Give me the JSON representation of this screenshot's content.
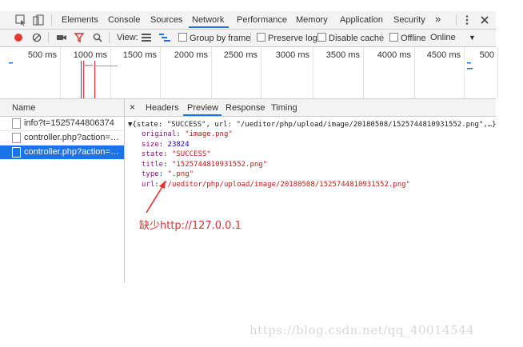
{
  "tabs": [
    "Elements",
    "Console",
    "Sources",
    "Network",
    "Performance",
    "Memory",
    "Application",
    "Security"
  ],
  "active_tab": "Network",
  "more_tabs": "»",
  "toolbar": {
    "view_label": "View:",
    "group_by_frame": "Group by frame",
    "preserve_log": "Preserve log",
    "disable_cache": "Disable cache",
    "offline": "Offline",
    "throttle": "Online"
  },
  "timeline": {
    "ticks": [
      "500 ms",
      "1000 ms",
      "1500 ms",
      "2000 ms",
      "2500 ms",
      "3000 ms",
      "3500 ms",
      "4000 ms",
      "4500 ms",
      "500"
    ]
  },
  "requests": {
    "header": "Name",
    "items": [
      {
        "name": "info?t=1525744806374"
      },
      {
        "name": "controller.php?action=upl..."
      },
      {
        "name": "controller.php?action=upl..."
      }
    ],
    "selected_index": 2
  },
  "detail_tabs": {
    "close": "×",
    "items": [
      "Headers",
      "Preview",
      "Response",
      "Timing"
    ],
    "active": "Preview"
  },
  "preview": {
    "summary": "{state: \"SUCCESS\", url: \"/ueditor/php/upload/image/20180508/1525744810931552.png\",…}",
    "fields": [
      {
        "key": "original",
        "value": "\"image.png\"",
        "type": "string"
      },
      {
        "key": "size",
        "value": "23824",
        "type": "number"
      },
      {
        "key": "state",
        "value": "\"SUCCESS\"",
        "type": "string"
      },
      {
        "key": "title",
        "value": "\"1525744810931552.png\"",
        "type": "string"
      },
      {
        "key": "type",
        "value": "\".png\"",
        "type": "string"
      },
      {
        "key": "url",
        "value": "\"/ueditor/php/upload/image/20180508/1525744810931552.png\"",
        "type": "string"
      }
    ]
  },
  "annotation": "缺少http://127.0.0.1",
  "watermark": "https://blog.csdn.net/qq_40014544",
  "colors": {
    "accent": "#1a73e8",
    "record": "#e53935",
    "annotation": "#e03030"
  }
}
